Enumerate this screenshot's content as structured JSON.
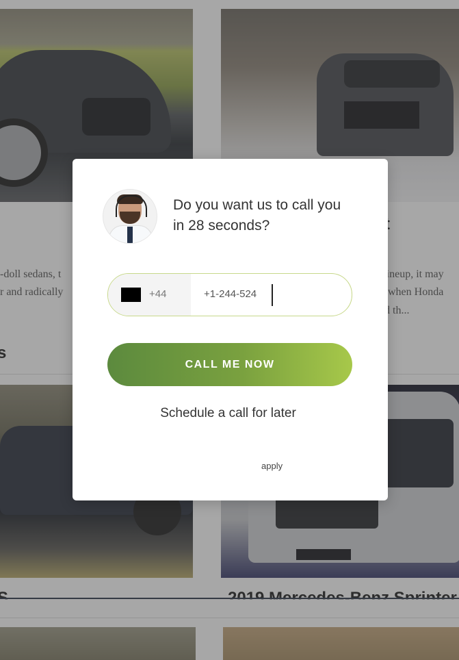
{
  "background": {
    "card_titles": [
      "t",
      "s",
      "2019 Mercedes-Benz Sprinter"
    ],
    "card_texts": [
      "-doll sedans, t",
      "r and radically",
      "s lineup, it may",
      "when Honda",
      "d th..."
    ],
    "card_prefixes": [
      "S"
    ]
  },
  "modal": {
    "question": "Do you want us to call you in 28 seconds?",
    "phone": {
      "country_prefix": "+44",
      "number": "+1-244-524"
    },
    "call_button": "CALL ME NOW",
    "schedule_link": "Schedule a call for later",
    "apply_link": "apply"
  },
  "colors": {
    "button_start": "#5c8a3e",
    "button_end": "#a7c84a",
    "field_border": "#c7d88a"
  }
}
